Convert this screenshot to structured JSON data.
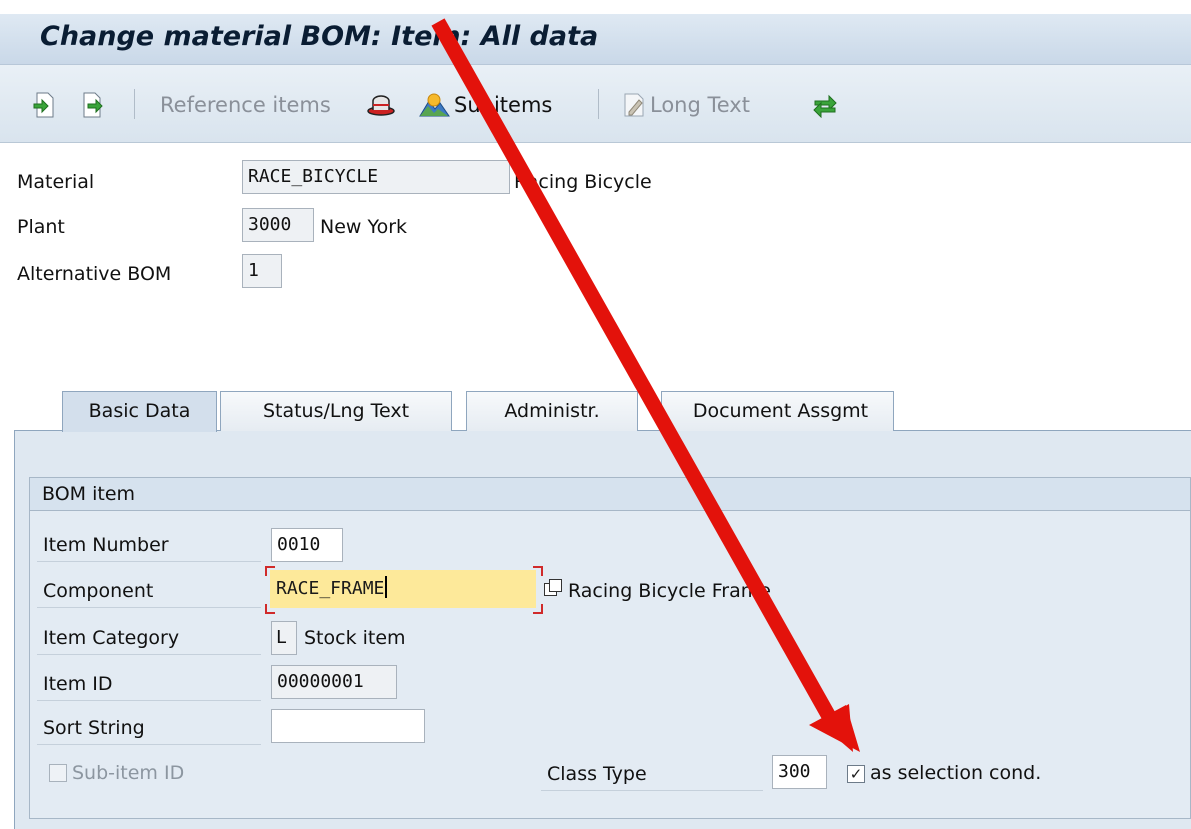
{
  "window": {
    "title": "Change material BOM: Item: All data"
  },
  "toolbar": {
    "reference_items": "Reference items",
    "subitems": "Subitems",
    "long_text": "Long Text"
  },
  "header": {
    "material_label": "Material",
    "material_value": "RACE_BICYCLE",
    "material_desc": "Racing Bicycle",
    "plant_label": "Plant",
    "plant_value": "3000",
    "plant_desc": "New York",
    "alt_bom_label": "Alternative BOM",
    "alt_bom_value": "1"
  },
  "tabs": [
    {
      "label": "Basic Data",
      "active": true
    },
    {
      "label": "Status/Lng Text",
      "active": false
    },
    {
      "label": "Administr.",
      "active": false
    },
    {
      "label": "Document Assgmt",
      "active": false
    }
  ],
  "bom_item": {
    "group_title": "BOM item",
    "item_number_label": "Item Number",
    "item_number_value": "0010",
    "component_label": "Component",
    "component_value": "RACE_FRAME",
    "component_desc": "Racing Bicycle Frame",
    "item_category_label": "Item Category",
    "item_category_value": "L",
    "item_category_desc": "Stock item",
    "item_id_label": "Item ID",
    "item_id_value": "00000001",
    "sort_string_label": "Sort String",
    "sort_string_value": "",
    "sub_item_id_label": "Sub-item ID",
    "class_type_label": "Class Type",
    "class_type_value": "300",
    "selection_cond_label": "as selection cond.",
    "selection_cond_checked": true
  },
  "colors": {
    "annotation_arrow": "#e3120b",
    "component_highlight": "#fde99a"
  }
}
